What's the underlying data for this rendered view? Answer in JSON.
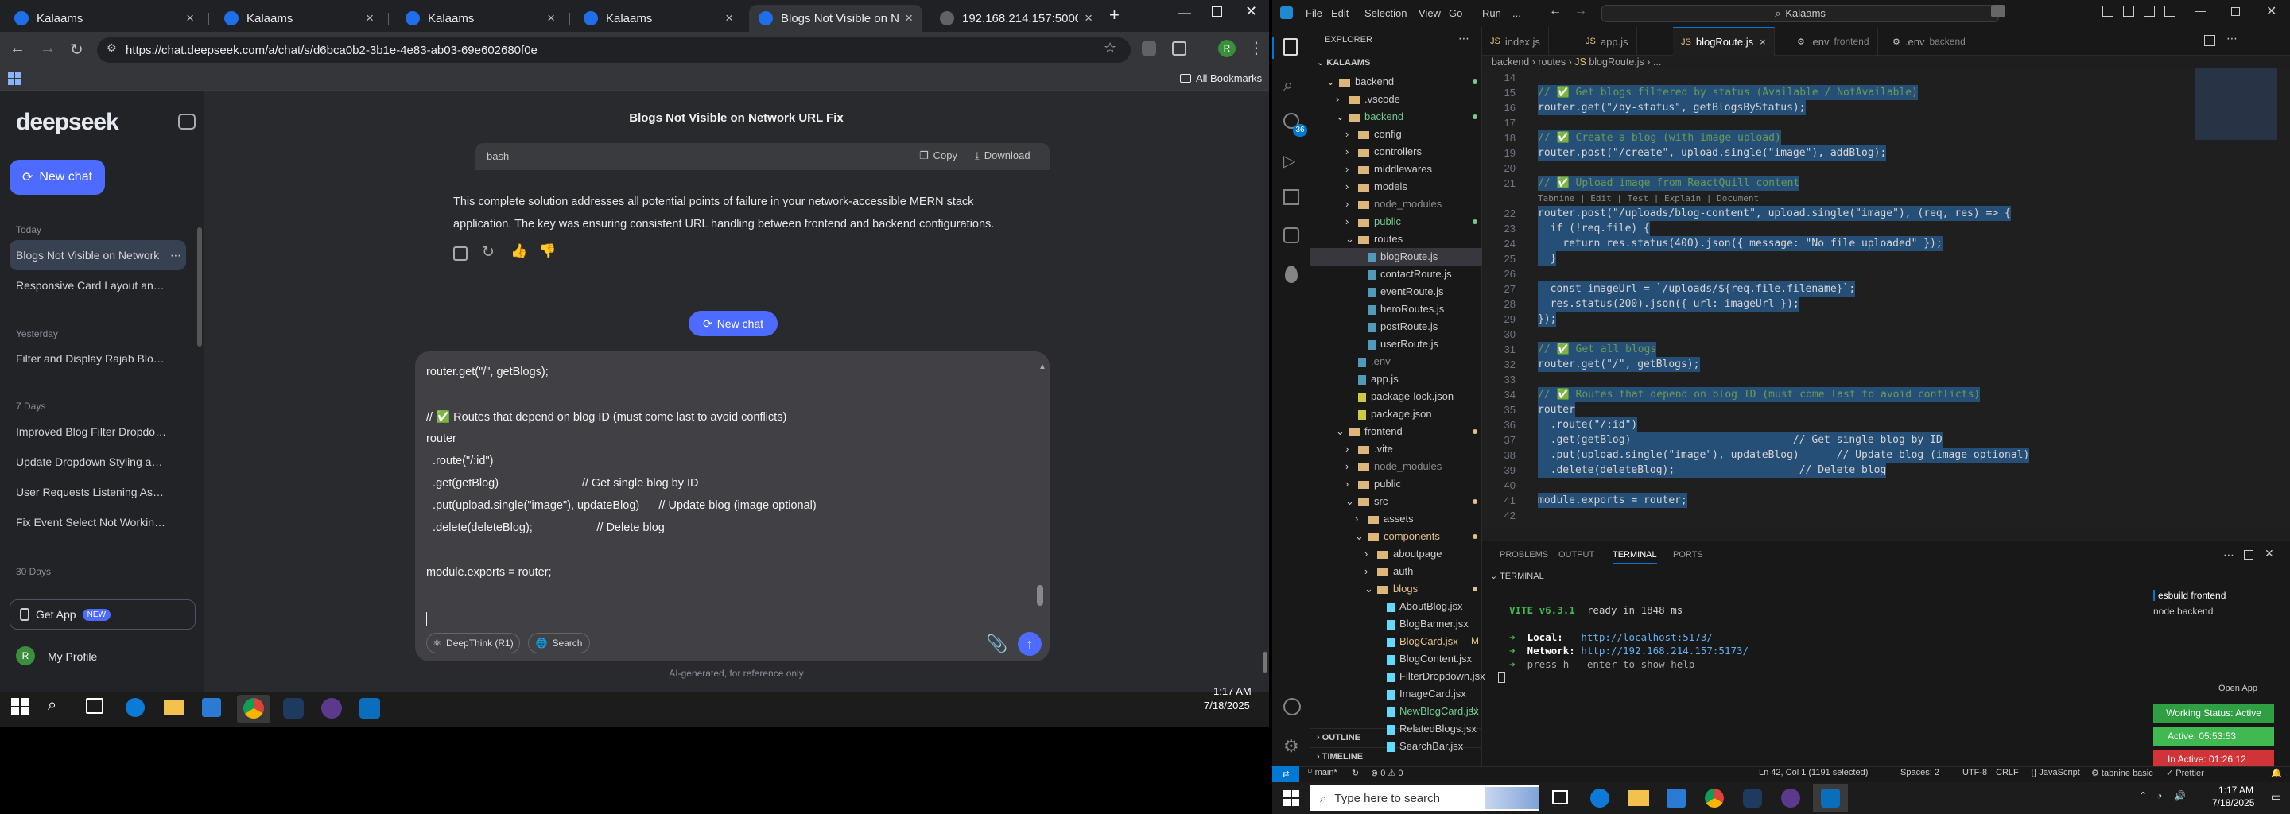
{
  "chrome": {
    "tabs": [
      {
        "label": "Kalaams"
      },
      {
        "label": "Kalaams"
      },
      {
        "label": "Kalaams"
      },
      {
        "label": "Kalaams"
      },
      {
        "label": "Blogs Not Visible on Network"
      },
      {
        "label": "192.168.214.157:5000/api/blo"
      }
    ],
    "url": "https://chat.deepseek.com/a/chat/s/d6bca0b2-3b1e-4e83-ab03-69e602680f0e",
    "all_bookmarks": "All Bookmarks"
  },
  "deepseek": {
    "logo": "deepseek",
    "new_chat": "New chat",
    "today": "Today",
    "yesterday": "Yesterday",
    "seven_days": "7 Days",
    "thirty_days": "30 Days",
    "chats_today": [
      "Blogs Not Visible on Network",
      "Responsive Card Layout and Alig"
    ],
    "chats_yesterday": [
      "Filter and Display Rajab Blog Ima"
    ],
    "chats_7days": [
      "Improved Blog Filter Dropdown",
      "Update Dropdown Styling and B",
      "User Requests Listening Assistan",
      "Fix Event Select Not Working in"
    ],
    "get_app": "Get App",
    "new_badge": "NEW",
    "profile": "My Profile",
    "chat_title": "Blogs Not Visible on Network URL Fix",
    "code_lang": "bash",
    "copy": "Copy",
    "download": "Download",
    "message": [
      "This complete solution addresses all potential points of failure in your network-accessible MERN stack",
      "application. The key was ensuring consistent URL handling between frontend and backend configurations."
    ],
    "new_chat_btn": "New chat",
    "input_lines": [
      "router.get(\"/\", getBlogs);",
      "",
      "// ✅ Routes that depend on blog ID (must come last to avoid conflicts)",
      "router",
      "  .route(\"/:id\")",
      "  .get(getBlog)                          // Get single blog by ID",
      "  .put(upload.single(\"image\"), updateBlog)      // Update blog (image optional)",
      "  .delete(deleteBlog);                    // Delete blog",
      "",
      "module.exports = router;"
    ],
    "deepthink": "DeepThink (R1)",
    "search": "Search",
    "disclaimer": "AI-generated, for reference only"
  },
  "taskbar_left": {
    "time": "1:17 AM",
    "date": "7/18/2025"
  },
  "vscode": {
    "search": "Kalaams",
    "menu": [
      "File",
      "Edit",
      "Selection",
      "View",
      "Go",
      "Run",
      "..."
    ],
    "explorer_title": "EXPLORER",
    "workspace": "KALAAMS",
    "badge": "36",
    "tree": [
      {
        "t": "backend",
        "d": 1,
        "o": true,
        "dot": "#73c991"
      },
      {
        "t": ".vscode",
        "d": 2,
        "o": false
      },
      {
        "t": "backend",
        "d": 2,
        "o": true,
        "dot": "#73c991",
        "c": "#73c991"
      },
      {
        "t": "config",
        "d": 3,
        "o": false
      },
      {
        "t": "controllers",
        "d": 3,
        "o": false
      },
      {
        "t": "middlewares",
        "d": 3,
        "o": false
      },
      {
        "t": "models",
        "d": 3,
        "o": false
      },
      {
        "t": "node_modules",
        "d": 3,
        "o": false,
        "c": "#8c8c8c"
      },
      {
        "t": "public",
        "d": 3,
        "o": false,
        "dot": "#73c991",
        "c": "#73c991"
      },
      {
        "t": "routes",
        "d": 3,
        "o": true
      },
      {
        "t": "blogRoute.js",
        "d": 4,
        "f": true,
        "sel": true
      },
      {
        "t": "contactRoute.js",
        "d": 4,
        "f": true
      },
      {
        "t": "eventRoute.js",
        "d": 4,
        "f": true
      },
      {
        "t": "heroRoutes.js",
        "d": 4,
        "f": true
      },
      {
        "t": "postRoute.js",
        "d": 4,
        "f": true
      },
      {
        "t": "userRoute.js",
        "d": 4,
        "f": true
      },
      {
        "t": ".env",
        "d": 3,
        "f": true,
        "c": "#8c8c8c"
      },
      {
        "t": "app.js",
        "d": 3,
        "f": true
      },
      {
        "t": "package-lock.json",
        "d": 3,
        "f": true
      },
      {
        "t": "package.json",
        "d": 3,
        "f": true
      },
      {
        "t": "frontend",
        "d": 2,
        "o": true,
        "dot": "#e2c08d"
      },
      {
        "t": ".vite",
        "d": 3,
        "o": false
      },
      {
        "t": "node_modules",
        "d": 3,
        "o": false,
        "c": "#8c8c8c"
      },
      {
        "t": "public",
        "d": 3,
        "o": false
      },
      {
        "t": "src",
        "d": 3,
        "o": true,
        "dot": "#e2c08d"
      },
      {
        "t": "assets",
        "d": 4,
        "o": false
      },
      {
        "t": "components",
        "d": 4,
        "o": true,
        "dot": "#e2c08d",
        "c": "#e2c08d"
      },
      {
        "t": "aboutpage",
        "d": 5,
        "o": false
      },
      {
        "t": "auth",
        "d": 5,
        "o": false
      },
      {
        "t": "blogs",
        "d": 5,
        "o": true,
        "dot": "#e2c08d",
        "c": "#e2c08d"
      },
      {
        "t": "AboutBlog.jsx",
        "d": 6,
        "f": true
      },
      {
        "t": "BlogBanner.jsx",
        "d": 6,
        "f": true
      },
      {
        "t": "BlogCard.jsx",
        "d": 6,
        "f": true,
        "c": "#e2c08d",
        "m": "M"
      },
      {
        "t": "BlogContent.jsx",
        "d": 6,
        "f": true
      },
      {
        "t": "FilterDropdown.jsx",
        "d": 6,
        "f": true
      },
      {
        "t": "ImageCard.jsx",
        "d": 6,
        "f": true
      },
      {
        "t": "NewBlogCard.jsx",
        "d": 6,
        "f": true,
        "c": "#73c991",
        "m": "U"
      },
      {
        "t": "RelatedBlogs.jsx",
        "d": 6,
        "f": true
      },
      {
        "t": "SearchBar.jsx",
        "d": 6,
        "f": true
      }
    ],
    "outline": "OUTLINE",
    "timeline": "TIMELINE",
    "tabs": [
      {
        "label": "index.js"
      },
      {
        "label": "app.js"
      },
      {
        "label": "blogRoute.js"
      },
      {
        "label": ".env",
        "sub": "frontend"
      },
      {
        "label": ".env",
        "sub": "backend"
      }
    ],
    "breadcrumb": [
      "backend",
      "routes",
      "blogRoute.js",
      "..."
    ],
    "code_lines": [
      {
        "n": "14",
        "t": ""
      },
      {
        "n": "15",
        "t": "// ✅ Get blogs filtered by status (Available / NotAvailable)"
      },
      {
        "n": "16",
        "t": "router.get(\"/by-status\", getBlogsByStatus);"
      },
      {
        "n": "17",
        "t": ""
      },
      {
        "n": "18",
        "t": "// ✅ Create a blog (with image upload)"
      },
      {
        "n": "19",
        "t": "router.post(\"/create\", upload.single(\"image\"), addBlog);"
      },
      {
        "n": "20",
        "t": ""
      },
      {
        "n": "21",
        "t": "// ✅ Upload image from ReactQuill content"
      },
      {
        "n": "",
        "t": "Tabnine | Edit | Test | Explain | Document"
      },
      {
        "n": "22",
        "t": "router.post(\"/uploads/blog-content\", upload.single(\"image\"), (req, res) => {"
      },
      {
        "n": "23",
        "t": "  if (!req.file) {"
      },
      {
        "n": "24",
        "t": "    return res.status(400).json({ message: \"No file uploaded\" });"
      },
      {
        "n": "25",
        "t": "  }"
      },
      {
        "n": "26",
        "t": ""
      },
      {
        "n": "27",
        "t": "  const imageUrl = `/uploads/${req.file.filename}`;"
      },
      {
        "n": "28",
        "t": "  res.status(200).json({ url: imageUrl });"
      },
      {
        "n": "29",
        "t": "});"
      },
      {
        "n": "30",
        "t": ""
      },
      {
        "n": "31",
        "t": "// ✅ Get all blogs"
      },
      {
        "n": "32",
        "t": "router.get(\"/\", getBlogs);"
      },
      {
        "n": "33",
        "t": ""
      },
      {
        "n": "34",
        "t": "// ✅ Routes that depend on blog ID (must come last to avoid conflicts)"
      },
      {
        "n": "35",
        "t": "router"
      },
      {
        "n": "36",
        "t": "  .route(\"/:id\")"
      },
      {
        "n": "37",
        "t": "  .get(getBlog)                          // Get single blog by ID"
      },
      {
        "n": "38",
        "t": "  .put(upload.single(\"image\"), updateBlog)      // Update blog (image optional)"
      },
      {
        "n": "39",
        "t": "  .delete(deleteBlog);                    // Delete blog"
      },
      {
        "n": "40",
        "t": ""
      },
      {
        "n": "41",
        "t": "module.exports = router;"
      },
      {
        "n": "42",
        "t": ""
      }
    ],
    "panel_tabs": [
      "PROBLEMS",
      "OUTPUT",
      "TERMINAL",
      "PORTS"
    ],
    "terminal_label": "TERMINAL",
    "term": {
      "vite": "VITE v6.3.1",
      "ready": "ready in 1848 ms",
      "local_l": "Local:",
      "local_u": "http://localhost:5173/",
      "net_l": "Network:",
      "net_u": "http://192.168.214.157:5173/",
      "help": "press h + enter to show help"
    },
    "term_list": [
      "esbuild frontend",
      "node backend"
    ],
    "open_app": "Open App",
    "working": "Working Status: Active",
    "active": "Active: 05:53:53",
    "inactive": "In Active: 01:26:12",
    "status": {
      "branch": "main*",
      "errors": "0",
      "warnings": "0",
      "pos": "Ln 42, Col 1 (1191 selected)",
      "spaces": "Spaces: 2",
      "enc": "UTF-8",
      "eol": "CRLF",
      "lang": "JavaScript",
      "tabnine": "tabnine basic",
      "prettier": "Prettier"
    }
  },
  "taskbar_right": {
    "search": "Type here to search",
    "time": "1:17 AM",
    "date": "7/18/2025"
  }
}
